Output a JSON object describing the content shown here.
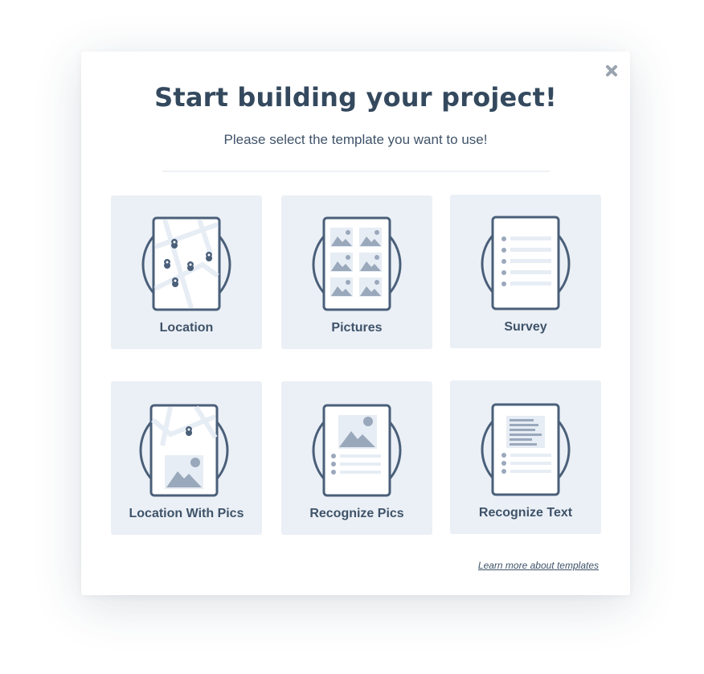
{
  "modal": {
    "title": "Start building your project!",
    "subtitle": "Please select the template you want to use!",
    "learn_more": "Learn more about templates"
  },
  "templates": [
    {
      "label": "Location",
      "icon": "location-template-icon"
    },
    {
      "label": "Pictures",
      "icon": "pictures-template-icon"
    },
    {
      "label": "Survey",
      "icon": "survey-template-icon"
    },
    {
      "label": "Location With Pics",
      "icon": "location-with-pics-template-icon"
    },
    {
      "label": "Recognize Pics",
      "icon": "recognize-pics-template-icon"
    },
    {
      "label": "Recognize Text",
      "icon": "recognize-text-template-icon"
    }
  ],
  "icons": {
    "close": "close-icon"
  },
  "colors": {
    "heading": "#34495e",
    "text": "#3f5369",
    "card_bg": "#ebf0f6",
    "outline": "#4a5f79",
    "graphic": "#9aa8bc"
  }
}
